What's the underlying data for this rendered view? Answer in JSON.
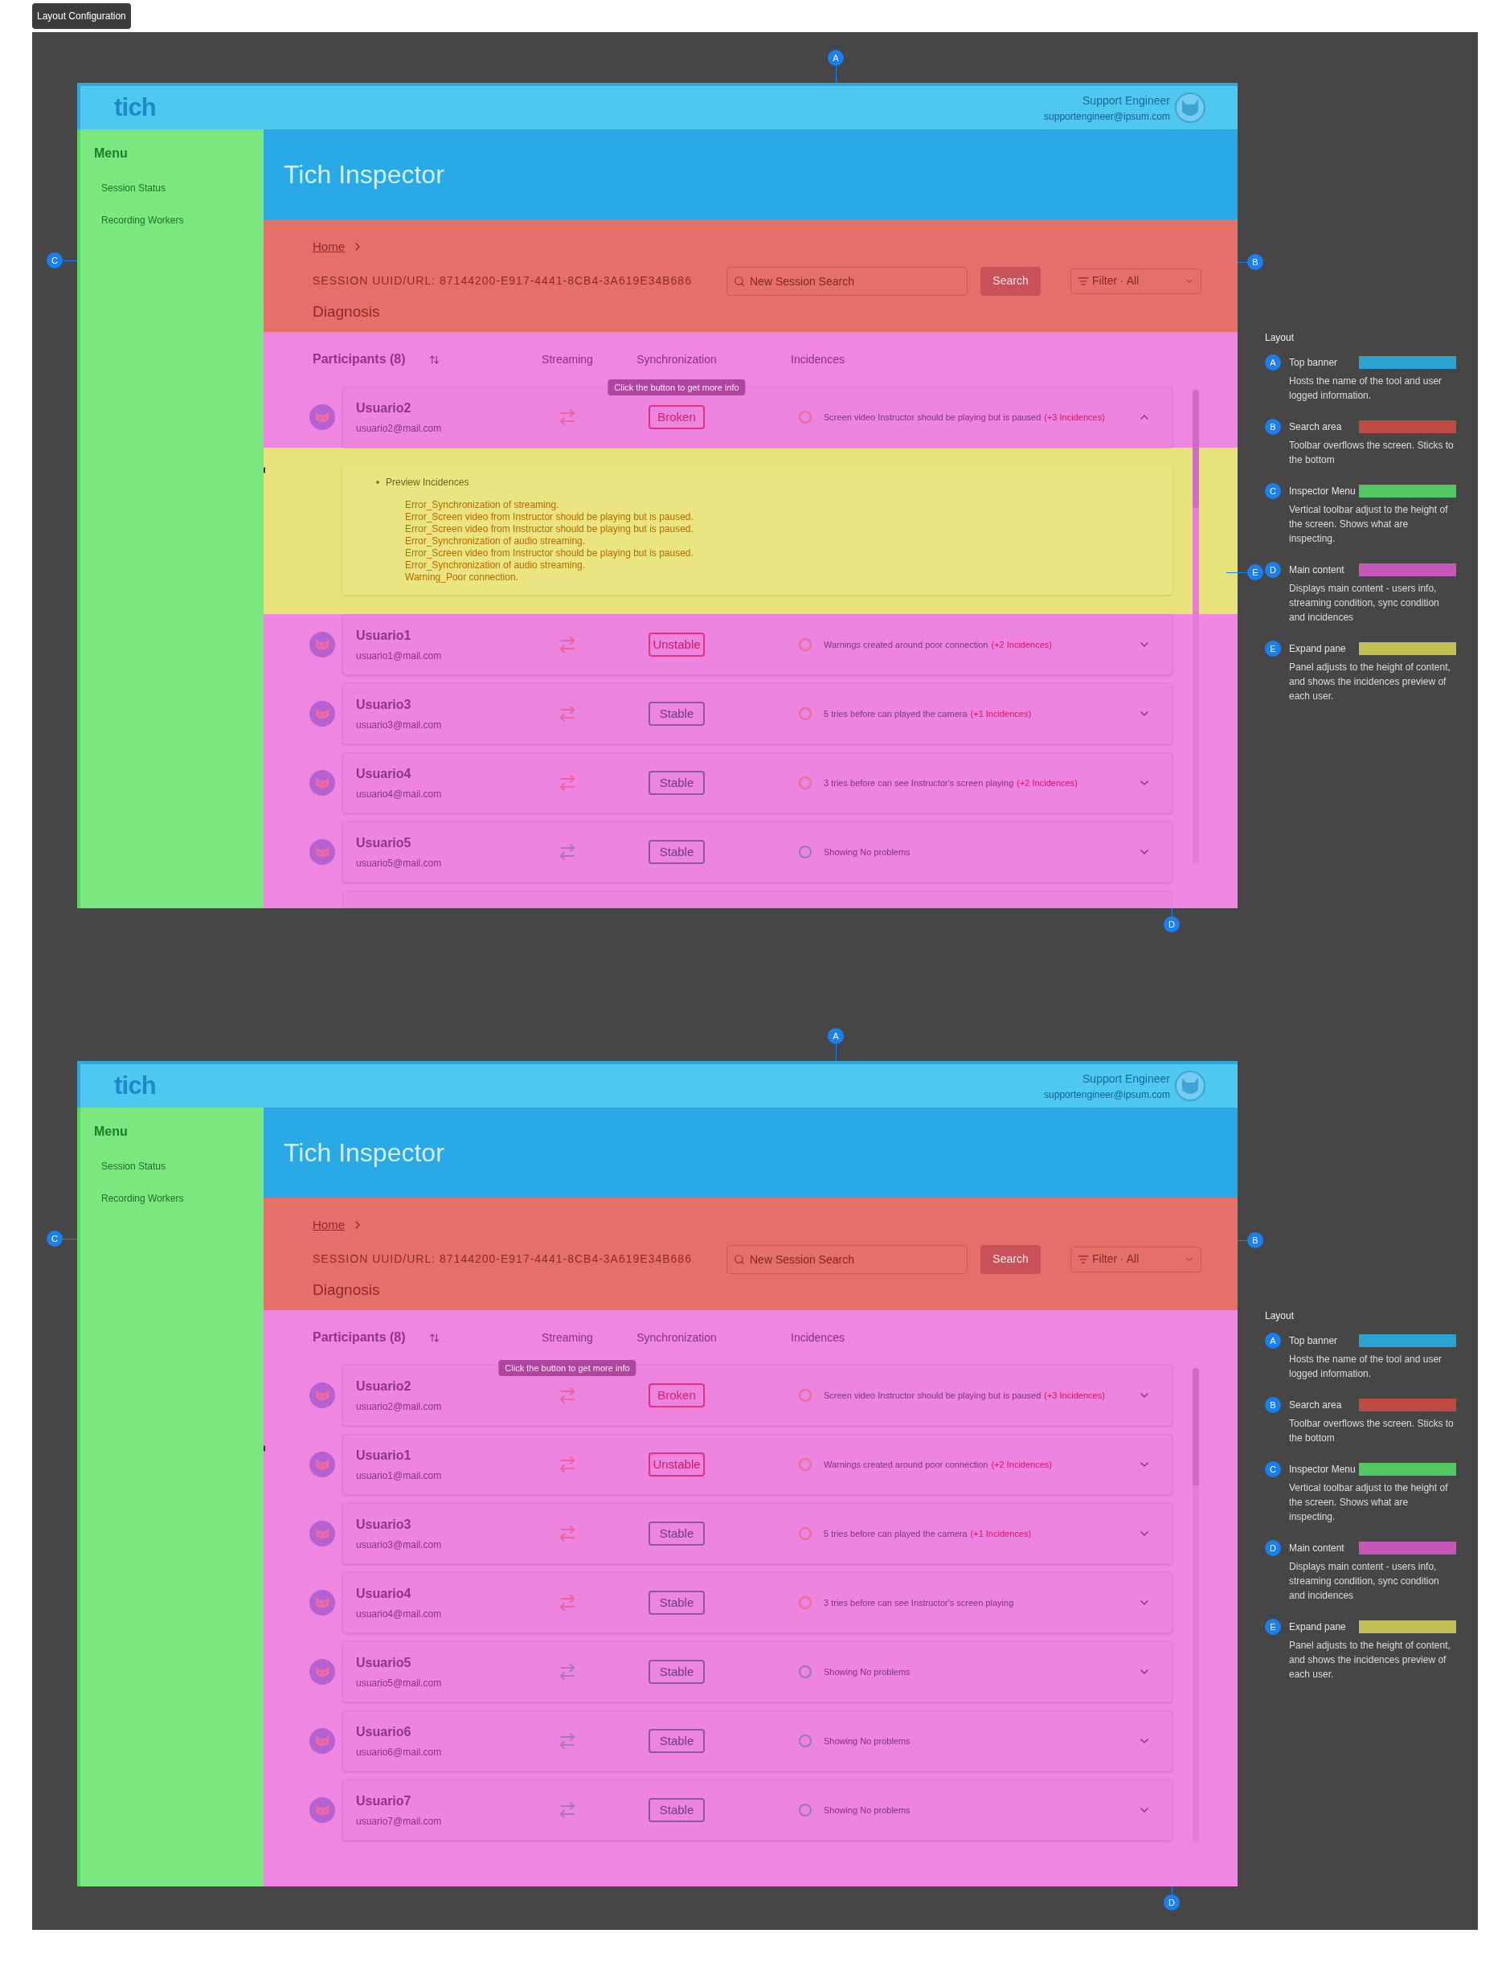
{
  "label": "Layout Configuration",
  "frames": [
    {
      "header": {
        "logo": "tich",
        "user_name": "Support Engineer",
        "user_email": "supportengineer@ipsum.com"
      },
      "sidebar": {
        "title": "Menu",
        "items": [
          "Session Status",
          "Recording Workers"
        ]
      },
      "page_title": "Tich Inspector",
      "search_area": {
        "breadcrumb": "Home",
        "session": "SESSION UUID/URL: 87144200-E917-4441-8CB4-3A619E34B686",
        "search": {
          "placeholder": "New Session Search"
        },
        "search_button": "Search",
        "filter": "Filter · All",
        "heading": "Diagnosis"
      },
      "participants": {
        "title": "Participants (8)",
        "columns": [
          "Streaming",
          "Synchronization",
          "Incidences"
        ],
        "cut_row": true,
        "rows": [
          {
            "name": "Usuario2",
            "email": "usuario2@mail.com",
            "alert": true,
            "kind": "broken",
            "sync": "Broken",
            "incidence": "Screen video Instructor should be playing but is paused",
            "count": "(+3 Incidences)",
            "expanded": true,
            "tooltip": {
              "text": "Click the button to get more info",
              "kind": "sync"
            },
            "preview": {
              "title": "Preview Incidences",
              "lines": [
                "Error_Synchronization of streaming.",
                "Error_Screen video from Instructor should be playing but is paused.",
                "Error_Screen video from Instructor should be playing but is paused.",
                "Error_Synchronization of audio streaming.",
                "Error_Screen video from Instructor should be playing but is paused.",
                "Error_Synchronization of audio streaming.",
                "Warning_Poor connection."
              ]
            }
          },
          {
            "name": "Usuario1",
            "email": "usuario1@mail.com",
            "alert": true,
            "kind": "unstable",
            "sync": "Unstable",
            "incidence": "Warnings created around poor connection",
            "count": "(+2 Incidences)",
            "expanded": false
          },
          {
            "name": "Usuario3",
            "email": "usuario3@mail.com",
            "alert": true,
            "kind": "stable",
            "sync": "Stable",
            "incidence": "5 tries before can played the camera",
            "count": "(+1 Incidences)",
            "expanded": false
          },
          {
            "name": "Usuario4",
            "email": "usuario4@mail.com",
            "alert": true,
            "kind": "stable",
            "sync": "Stable",
            "incidence": "3 tries before can see Instructor's screen playing",
            "count": "(+2 Incidences)",
            "expanded": false
          },
          {
            "name": "Usuario5",
            "email": "usuario5@mail.com",
            "alert": false,
            "kind": "stable",
            "sync": "Stable",
            "incidence": "Showing No problems",
            "expanded": false
          }
        ]
      },
      "markers": [
        {
          "letter": "A",
          "kind": "top"
        },
        {
          "letter": "B",
          "kind": "right"
        },
        {
          "letter": "C",
          "kind": "left"
        },
        {
          "letter": "D",
          "kind": "bottom"
        },
        {
          "letter": "E",
          "kind": "pane"
        }
      ],
      "legend": {
        "title": "Layout",
        "items": [
          {
            "letter": "A",
            "title": "Top banner",
            "color": "#2ba3d1",
            "text": "Hosts the name of the tool and user logged information."
          },
          {
            "letter": "B",
            "title": "Search area",
            "color": "#bd4a45",
            "text": "Toolbar overflows the screen. Sticks to the bottom"
          },
          {
            "letter": "C",
            "title": "Inspector Menu",
            "color": "#52c865",
            "text": "Vertical toolbar adjust to the height of the screen. Shows what are inspecting."
          },
          {
            "letter": "D",
            "title": "Main content",
            "color": "#c756b9",
            "text": "Displays main content - users info, streaming condition, sync condition and incidences"
          },
          {
            "letter": "E",
            "title": "Expand pane",
            "color": "#c4bf55",
            "text": "Panel adjusts to the height of content, and shows the incidences preview of each user."
          }
        ]
      }
    },
    {
      "header": {
        "logo": "tich",
        "user_name": "Support Engineer",
        "user_email": "supportengineer@ipsum.com"
      },
      "sidebar": {
        "title": "Menu",
        "items": [
          "Session Status",
          "Recording Workers"
        ]
      },
      "page_title": "Tich Inspector",
      "search_area": {
        "breadcrumb": "Home",
        "session": "SESSION UUID/URL: 87144200-E917-4441-8CB4-3A619E34B686",
        "search": {
          "placeholder": "New Session Search"
        },
        "search_button": "Search",
        "filter": "Filter · All",
        "heading": "Diagnosis"
      },
      "participants": {
        "title": "Participants (8)",
        "columns": [
          "Streaming",
          "Synchronization",
          "Incidences"
        ],
        "cut_row": false,
        "rows": [
          {
            "name": "Usuario2",
            "email": "usuario2@mail.com",
            "alert": true,
            "kind": "broken",
            "sync": "Broken",
            "incidence": "Screen video Instructor should be playing but is paused",
            "count": "(+3 Incidences)",
            "expanded": false,
            "tooltip": {
              "text": "Click the button to get more info",
              "kind": "streaming"
            }
          },
          {
            "name": "Usuario1",
            "email": "usuario1@mail.com",
            "alert": true,
            "kind": "unstable",
            "sync": "Unstable",
            "incidence": "Warnings created around poor connection",
            "count": "(+2 Incidences)",
            "expanded": false
          },
          {
            "name": "Usuario3",
            "email": "usuario3@mail.com",
            "alert": true,
            "kind": "stable",
            "sync": "Stable",
            "incidence": "5 tries before can played the camera",
            "count": "(+1 Incidences)",
            "expanded": false
          },
          {
            "name": "Usuario4",
            "email": "usuario4@mail.com",
            "alert": true,
            "kind": "stable",
            "sync": "Stable",
            "incidence": "3 tries before can see Instructor's screen playing",
            "expanded": false
          },
          {
            "name": "Usuario5",
            "email": "usuario5@mail.com",
            "alert": false,
            "kind": "stable",
            "sync": "Stable",
            "incidence": "Showing No problems",
            "expanded": false
          },
          {
            "name": "Usuario6",
            "email": "usuario6@mail.com",
            "alert": false,
            "kind": "stable",
            "sync": "Stable",
            "incidence": "Showing No problems",
            "expanded": false
          },
          {
            "name": "Usuario7",
            "email": "usuario7@mail.com",
            "alert": false,
            "kind": "stable",
            "sync": "Stable",
            "incidence": "Showing No problems",
            "expanded": false
          }
        ]
      },
      "markers": [
        {
          "letter": "A",
          "kind": "top"
        },
        {
          "letter": "B",
          "kind": "right"
        },
        {
          "letter": "C",
          "kind": "left"
        },
        {
          "letter": "D",
          "kind": "bottom"
        }
      ],
      "legend": {
        "title": "Layout",
        "items": [
          {
            "letter": "A",
            "title": "Top banner",
            "color": "#2ba3d1",
            "text": "Hosts the name of the tool and user logged information."
          },
          {
            "letter": "B",
            "title": "Search area",
            "color": "#bd4a45",
            "text": "Toolbar overflows the screen. Sticks to the bottom"
          },
          {
            "letter": "C",
            "title": "Inspector Menu",
            "color": "#52c865",
            "text": "Vertical toolbar adjust to the height of the screen. Shows what are inspecting."
          },
          {
            "letter": "D",
            "title": "Main content",
            "color": "#c756b9",
            "text": "Displays main content - users info, streaming condition, sync condition and incidences"
          },
          {
            "letter": "E",
            "title": "Expand pane",
            "color": "#c4bf55",
            "text": "Panel adjusts to the height of content, and shows the incidences preview of each user."
          }
        ]
      }
    }
  ]
}
